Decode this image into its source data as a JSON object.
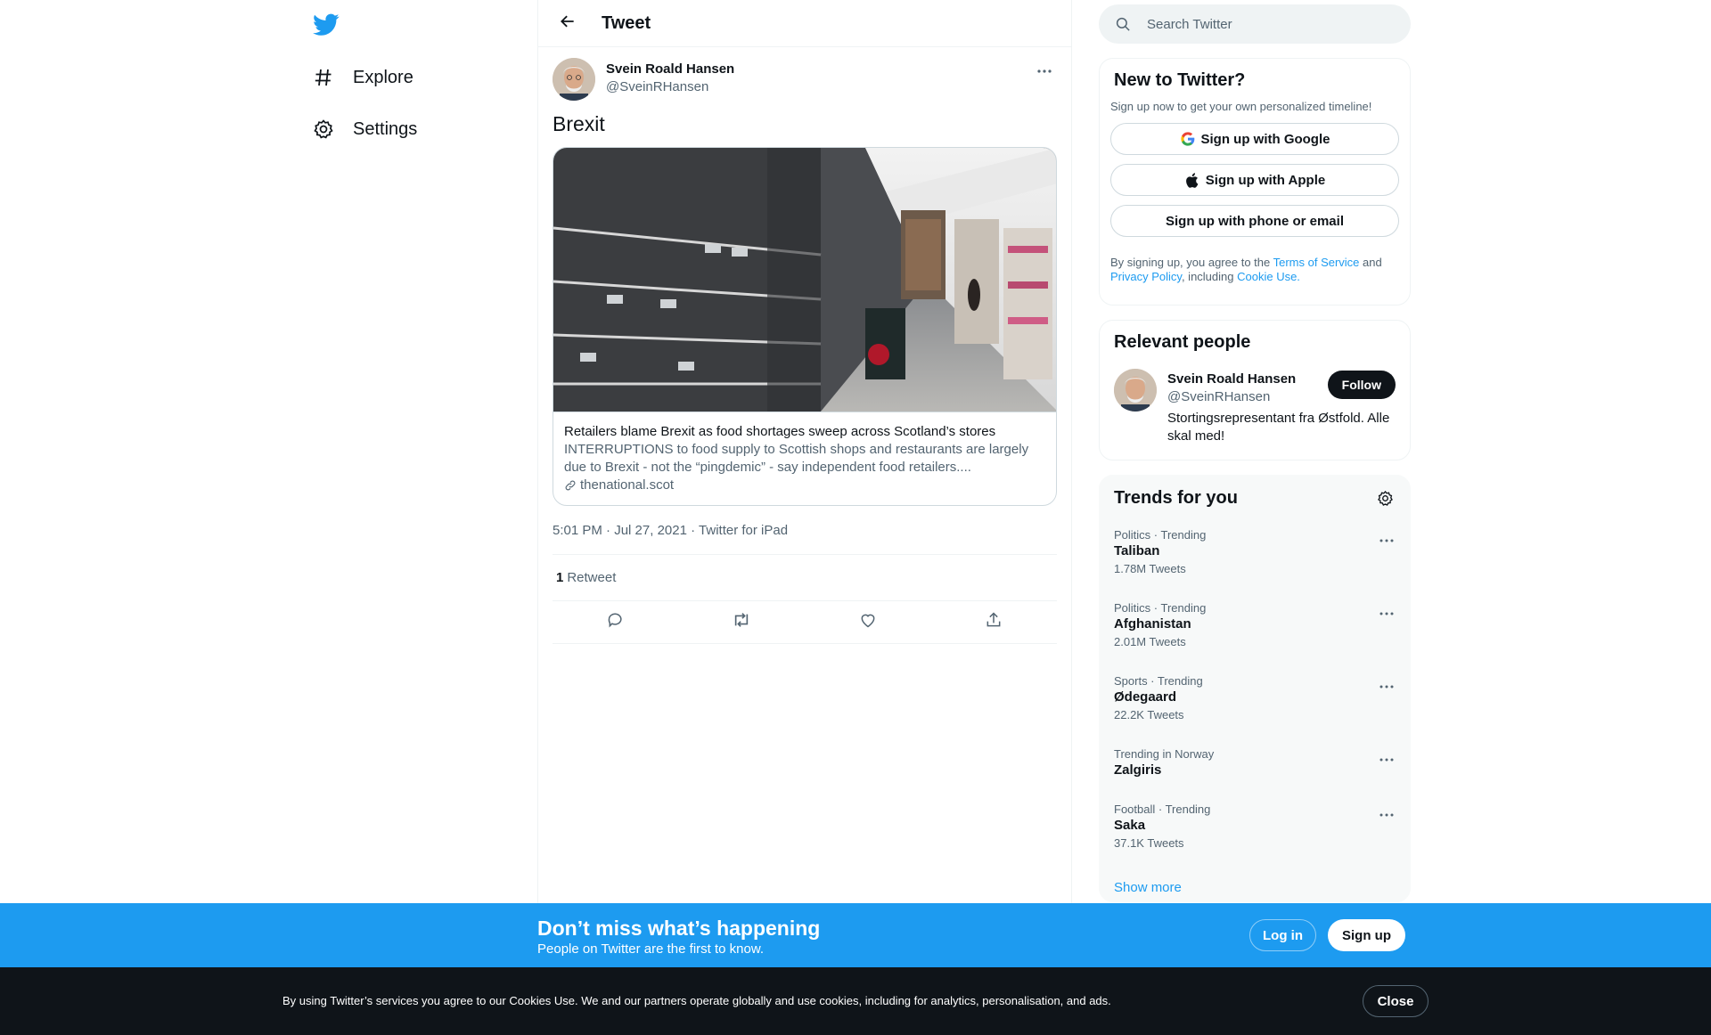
{
  "colors": {
    "brand": "#1d9bf0",
    "text": "#0f1419",
    "secondary": "#536471",
    "border": "#eff3f4"
  },
  "nav": {
    "logo_icon": "twitter-bird-icon",
    "items": [
      {
        "label": "Explore",
        "icon": "hashtag-icon"
      },
      {
        "label": "Settings",
        "icon": "gear-icon"
      }
    ]
  },
  "header": {
    "title": "Tweet",
    "back_icon": "arrow-left-icon"
  },
  "tweet": {
    "author_name": "Svein Roald Hansen",
    "author_handle": "@SveinRHansen",
    "text": "Brexit",
    "card": {
      "title": "Retailers blame Brexit as food shortages sweep across Scotland’s stores",
      "description": "INTERRUPTIONS to food supply to Scottish shops and restaurants are largely due to Brexit - not the “pingdemic” - say independent food retailers....",
      "domain": "thenational.scot"
    },
    "time": "5:01 PM",
    "date": "Jul 27, 2021",
    "source": "Twitter for iPad",
    "retweet_count": "1",
    "retweet_label": "Retweet"
  },
  "search": {
    "placeholder": "Search Twitter"
  },
  "new_to_twitter": {
    "title": "New to Twitter?",
    "subtitle": "Sign up now to get your own personalized timeline!",
    "google_label": "Sign up with Google",
    "apple_label": "Sign up with Apple",
    "phone_label": "Sign up with phone or email",
    "legal_prefix": "By signing up, you agree to the ",
    "terms": "Terms of Service",
    "and": " and ",
    "privacy": "Privacy Policy",
    "including": ", including ",
    "cookie": "Cookie Use."
  },
  "relevant_people": {
    "title": "Relevant people",
    "name": "Svein Roald Hansen",
    "handle": "@SveinRHansen",
    "bio": "Stortingsrepresentant fra Østfold. Alle skal med!",
    "follow_label": "Follow"
  },
  "trends": {
    "title": "Trends for you",
    "items": [
      {
        "context": "Politics · Trending",
        "name": "Taliban",
        "count": "1.78M Tweets"
      },
      {
        "context": "Politics · Trending",
        "name": "Afghanistan",
        "count": "2.01M Tweets"
      },
      {
        "context": "Sports · Trending",
        "name": "Ødegaard",
        "count": "22.2K Tweets"
      },
      {
        "context": "Trending in Norway",
        "name": "Zalgiris",
        "count": ""
      },
      {
        "context": "Football · Trending",
        "name": "Saka",
        "count": "37.1K Tweets"
      }
    ],
    "show_more": "Show more"
  },
  "bottom_bar": {
    "title": "Don’t miss what’s happening",
    "subtitle": "People on Twitter are the first to know.",
    "login": "Log in",
    "signup": "Sign up"
  },
  "cookie_bar": {
    "text": "By using Twitter’s services you agree to our Cookies Use. We and our partners operate globally and use cookies, including for analytics, personalisation, and ads.",
    "close": "Close"
  }
}
